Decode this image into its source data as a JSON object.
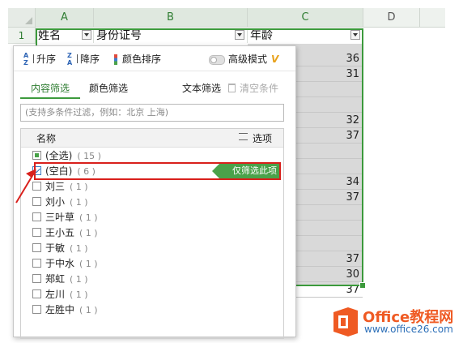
{
  "sheet": {
    "row_number": "1",
    "columns": [
      "A",
      "B",
      "C",
      "D"
    ],
    "header_cells": {
      "a": "姓名",
      "b": "身份证号",
      "c": "年龄"
    },
    "age_values": [
      "36",
      "31",
      "",
      "",
      "32",
      "37",
      "",
      "",
      "34",
      "37",
      "",
      "",
      "",
      "37",
      "30",
      "37"
    ]
  },
  "filter_panel": {
    "toolbar": {
      "sort_asc": "升序",
      "sort_desc": "降序",
      "color_sort": "颜色排序",
      "advanced_mode": "高级模式",
      "advanced_icon": "V"
    },
    "tabs": {
      "content_filter": "内容筛选",
      "color_filter": "颜色筛选"
    },
    "text_filter": "文本筛选",
    "clear_condition": "清空条件",
    "search_placeholder": "(支持多条件过滤，例如：北京  上海)",
    "list_header": {
      "name": "名称",
      "options": "选项"
    },
    "items": [
      {
        "label": "(全选)",
        "count": "( 15 )",
        "state": "partial"
      },
      {
        "label": "(空白)",
        "count": "( 6 )",
        "state": "checked"
      },
      {
        "label": "刘三",
        "count": "( 1 )",
        "state": "unchecked"
      },
      {
        "label": "刘小",
        "count": "( 1 )",
        "state": "unchecked"
      },
      {
        "label": "三叶草",
        "count": "( 1 )",
        "state": "unchecked"
      },
      {
        "label": "王小五",
        "count": "( 1 )",
        "state": "unchecked"
      },
      {
        "label": "于敏",
        "count": "( 1 )",
        "state": "unchecked"
      },
      {
        "label": "于中水",
        "count": "( 1 )",
        "state": "unchecked"
      },
      {
        "label": "郑虹",
        "count": "( 1 )",
        "state": "unchecked"
      },
      {
        "label": "左川",
        "count": "( 1 )",
        "state": "unchecked"
      },
      {
        "label": "左胜中",
        "count": "( 1 )",
        "state": "unchecked"
      }
    ],
    "only_filter_this": "仅筛选此项"
  },
  "watermark": {
    "brand": "Office教程网",
    "url": "www.office26.com"
  },
  "colors": {
    "accent_green": "#3c9a3c",
    "highlight_red": "#d9201c",
    "brand_orange": "#ef5a23",
    "brand_blue": "#2c6fb8"
  }
}
